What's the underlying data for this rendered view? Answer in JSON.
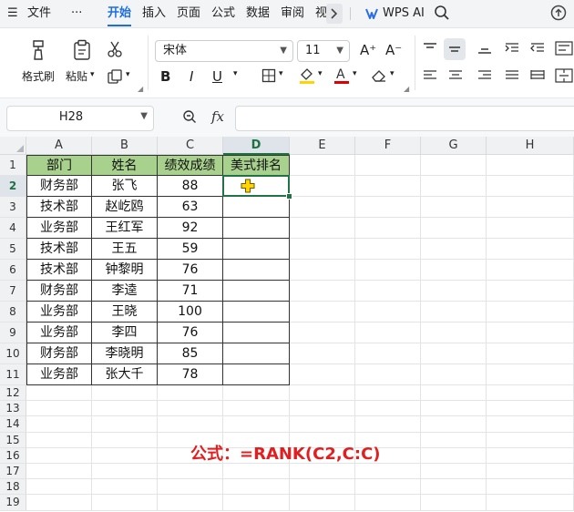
{
  "menubar": {
    "file_label": "文件",
    "more_label": "···",
    "tabs": [
      "开始",
      "插入",
      "页面",
      "公式",
      "数据",
      "审阅",
      "视"
    ],
    "wps_ai_label": "WPS AI"
  },
  "ribbon": {
    "format_painter_label": "格式刷",
    "paste_label": "粘贴",
    "font_name": "宋体",
    "font_size": "11",
    "grow_font": "A⁺",
    "shrink_font": "A⁻",
    "bold": "B",
    "italic": "I",
    "underline": "U",
    "font_color_letter": "A",
    "fill_color": "#ffd400",
    "font_color": "#e00000"
  },
  "formula_bar": {
    "name_box": "H28",
    "fx_label": "fx",
    "formula": ""
  },
  "sheet": {
    "columns": [
      "A",
      "B",
      "C",
      "D",
      "E",
      "F",
      "G",
      "H"
    ],
    "rows": [
      "1",
      "2",
      "3",
      "4",
      "5",
      "6",
      "7",
      "8",
      "9",
      "10",
      "11",
      "12",
      "13",
      "14",
      "15",
      "16",
      "17",
      "18",
      "19"
    ],
    "headers": [
      "部门",
      "姓名",
      "绩效成绩",
      "美式排名"
    ],
    "data": [
      [
        "财务部",
        "张飞",
        "88",
        ""
      ],
      [
        "技术部",
        "赵屹鸥",
        "63",
        ""
      ],
      [
        "业务部",
        "王红军",
        "92",
        ""
      ],
      [
        "技术部",
        "王五",
        "59",
        ""
      ],
      [
        "技术部",
        "钟黎明",
        "76",
        ""
      ],
      [
        "财务部",
        "李逵",
        "71",
        ""
      ],
      [
        "业务部",
        "王晓",
        "100",
        ""
      ],
      [
        "业务部",
        "李四",
        "76",
        ""
      ],
      [
        "财务部",
        "李晓明",
        "85",
        ""
      ],
      [
        "业务部",
        "张大千",
        "78",
        ""
      ]
    ],
    "header_fill": "#a9d18e",
    "selection_color": "#217346"
  },
  "annotation": "公式：=RANK(C2,C:C)"
}
